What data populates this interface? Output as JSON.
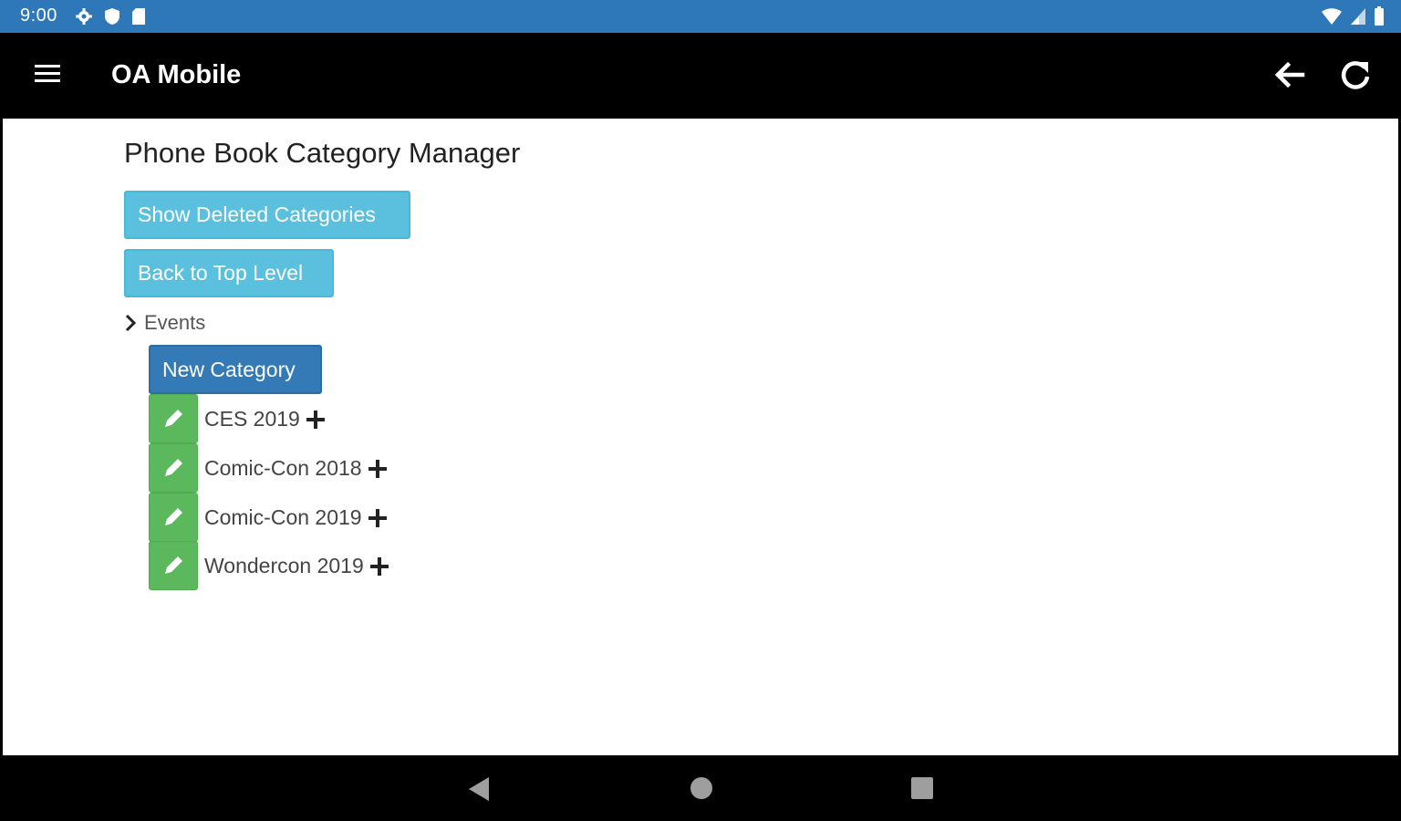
{
  "status_bar": {
    "time": "9:00",
    "icons_left": [
      "gear-icon",
      "shield-icon",
      "sd-card-icon"
    ],
    "icons_right": [
      "wifi-icon",
      "cell-signal-icon",
      "battery-icon"
    ],
    "color": "#2e78b9"
  },
  "app_bar": {
    "title": "OA Mobile",
    "icons": [
      "menu-icon",
      "back-arrow-icon",
      "refresh-icon"
    ]
  },
  "main": {
    "page_title": "Phone Book Category Manager",
    "buttons": {
      "show_deleted": "Show Deleted Categories",
      "back_to_top": "Back to Top Level",
      "new_category": "New Category"
    },
    "tree": {
      "parent_label": "Events",
      "children": [
        {
          "label": "CES 2019"
        },
        {
          "label": "Comic-Con 2018"
        },
        {
          "label": "Comic-Con 2019"
        },
        {
          "label": "Wondercon 2019"
        }
      ]
    },
    "colors": {
      "info": "#5bc0de",
      "primary": "#337ab7",
      "success": "#5cb85c"
    }
  },
  "nav_bar": {
    "icons": [
      "nav-back-icon",
      "nav-home-icon",
      "nav-recents-icon"
    ]
  }
}
